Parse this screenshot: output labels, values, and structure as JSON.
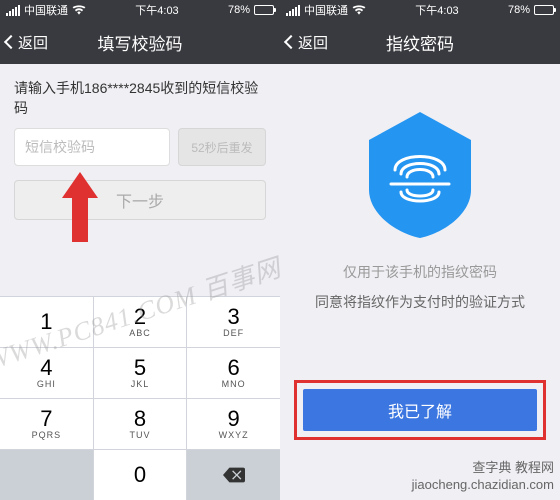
{
  "status": {
    "carrier": "中国联通",
    "time": "下午4:03",
    "battery": "78%"
  },
  "left": {
    "back": "返回",
    "title": "填写校验码",
    "instruction": "请输入手机186****2845收到的短信校验码",
    "placeholder": "短信校验码",
    "resend": "52秒后重发",
    "next": "下一步",
    "watermark": "WWW.PC841.COM 百事网",
    "keypad": [
      {
        "n": "1",
        "s": ""
      },
      {
        "n": "2",
        "s": "ABC"
      },
      {
        "n": "3",
        "s": "DEF"
      },
      {
        "n": "4",
        "s": "GHI"
      },
      {
        "n": "5",
        "s": "JKL"
      },
      {
        "n": "6",
        "s": "MNO"
      },
      {
        "n": "7",
        "s": "PQRS"
      },
      {
        "n": "8",
        "s": "TUV"
      },
      {
        "n": "9",
        "s": "WXYZ"
      },
      {
        "n": "",
        "s": ""
      },
      {
        "n": "0",
        "s": ""
      },
      {
        "n": "del",
        "s": ""
      }
    ]
  },
  "right": {
    "back": "返回",
    "title": "指纹密码",
    "line1": "仅用于该手机的指纹密码",
    "line2": "同意将指纹作为支付时的验证方式",
    "cta": "我已了解"
  },
  "corner": {
    "l1": "查字典 教程网",
    "l2": "jiaocheng.chazidian.com"
  }
}
